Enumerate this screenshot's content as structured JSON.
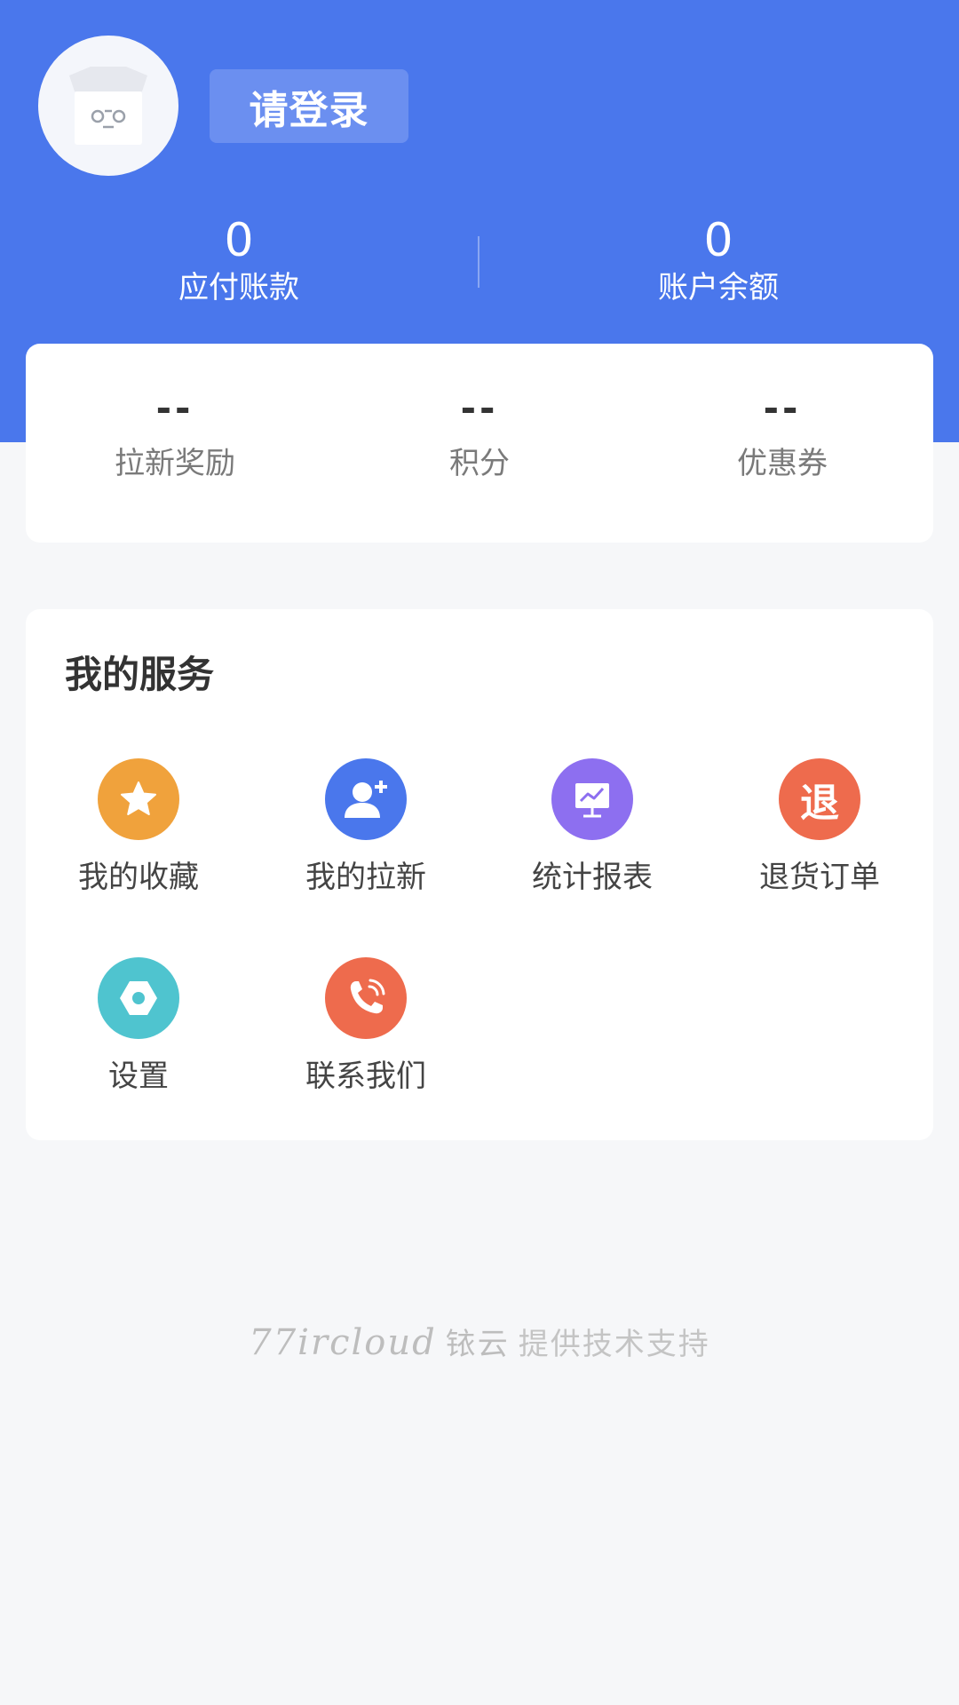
{
  "header": {
    "login_label": "请登录",
    "stats": [
      {
        "value": "0",
        "label": "应付账款"
      },
      {
        "value": "0",
        "label": "账户余额"
      }
    ]
  },
  "rewards": [
    {
      "value": "--",
      "label": "拉新奖励"
    },
    {
      "value": "--",
      "label": "积分"
    },
    {
      "value": "--",
      "label": "优惠券"
    }
  ],
  "services": {
    "title": "我的服务",
    "items": [
      {
        "label": "我的收藏",
        "icon": "star-icon",
        "color": "#f0a23c"
      },
      {
        "label": "我的拉新",
        "icon": "add-user-icon",
        "color": "#4a77ec"
      },
      {
        "label": "统计报表",
        "icon": "chart-icon",
        "color": "#8d6ff0"
      },
      {
        "label": "退货订单",
        "icon": "return-icon",
        "color": "#ee6b4d",
        "glyph": "退"
      },
      {
        "label": "设置",
        "icon": "settings-icon",
        "color": "#4fc4cf"
      },
      {
        "label": "联系我们",
        "icon": "phone-icon",
        "color": "#ee6b4d"
      }
    ]
  },
  "footer": {
    "brand": "77ircloud",
    "brand_cn": "铱云",
    "text": "提供技术支持"
  },
  "colors": {
    "primary": "#4a77ec",
    "background": "#f6f7f9"
  }
}
